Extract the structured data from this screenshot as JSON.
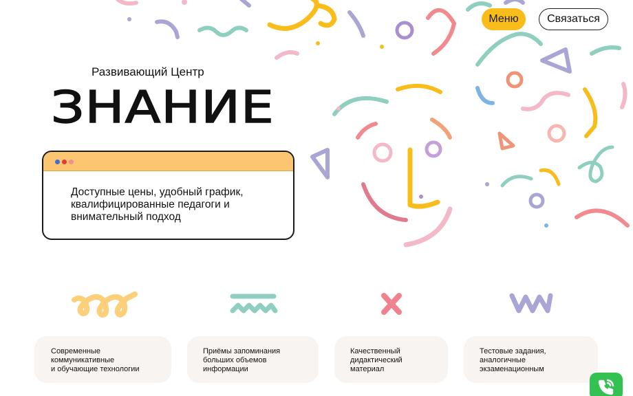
{
  "header": {
    "menu_label": "Меню",
    "contact_label": "Связаться"
  },
  "hero": {
    "subtitle": "Развивающий Центр",
    "title": "ЗНАНИЕ",
    "card_lines": [
      "Доступные цены, удобный график,",
      "квалифицированные педагоги и",
      "внимательный подход"
    ]
  },
  "features": [
    {
      "icon": "yellow-loops-icon",
      "lines": [
        "Современные",
        "коммуникативные",
        "и обучающие технологии"
      ]
    },
    {
      "icon": "teal-zigzag-icon",
      "lines": [
        "Приёмы запоминания",
        "больших объемов",
        "информации"
      ]
    },
    {
      "icon": "pink-cross-icon",
      "lines": [
        "Качественный",
        "дидактический",
        "материал"
      ]
    },
    {
      "icon": "purple-w-icon",
      "lines": [
        "Тестовые задания,",
        "аналогичные",
        "экзаменационным"
      ]
    }
  ],
  "colors": {
    "accent_yellow": "#f8bd1b",
    "card_header": "#fcc572",
    "call_green": "#33c251",
    "feature_bg": "#f7f4f1"
  }
}
